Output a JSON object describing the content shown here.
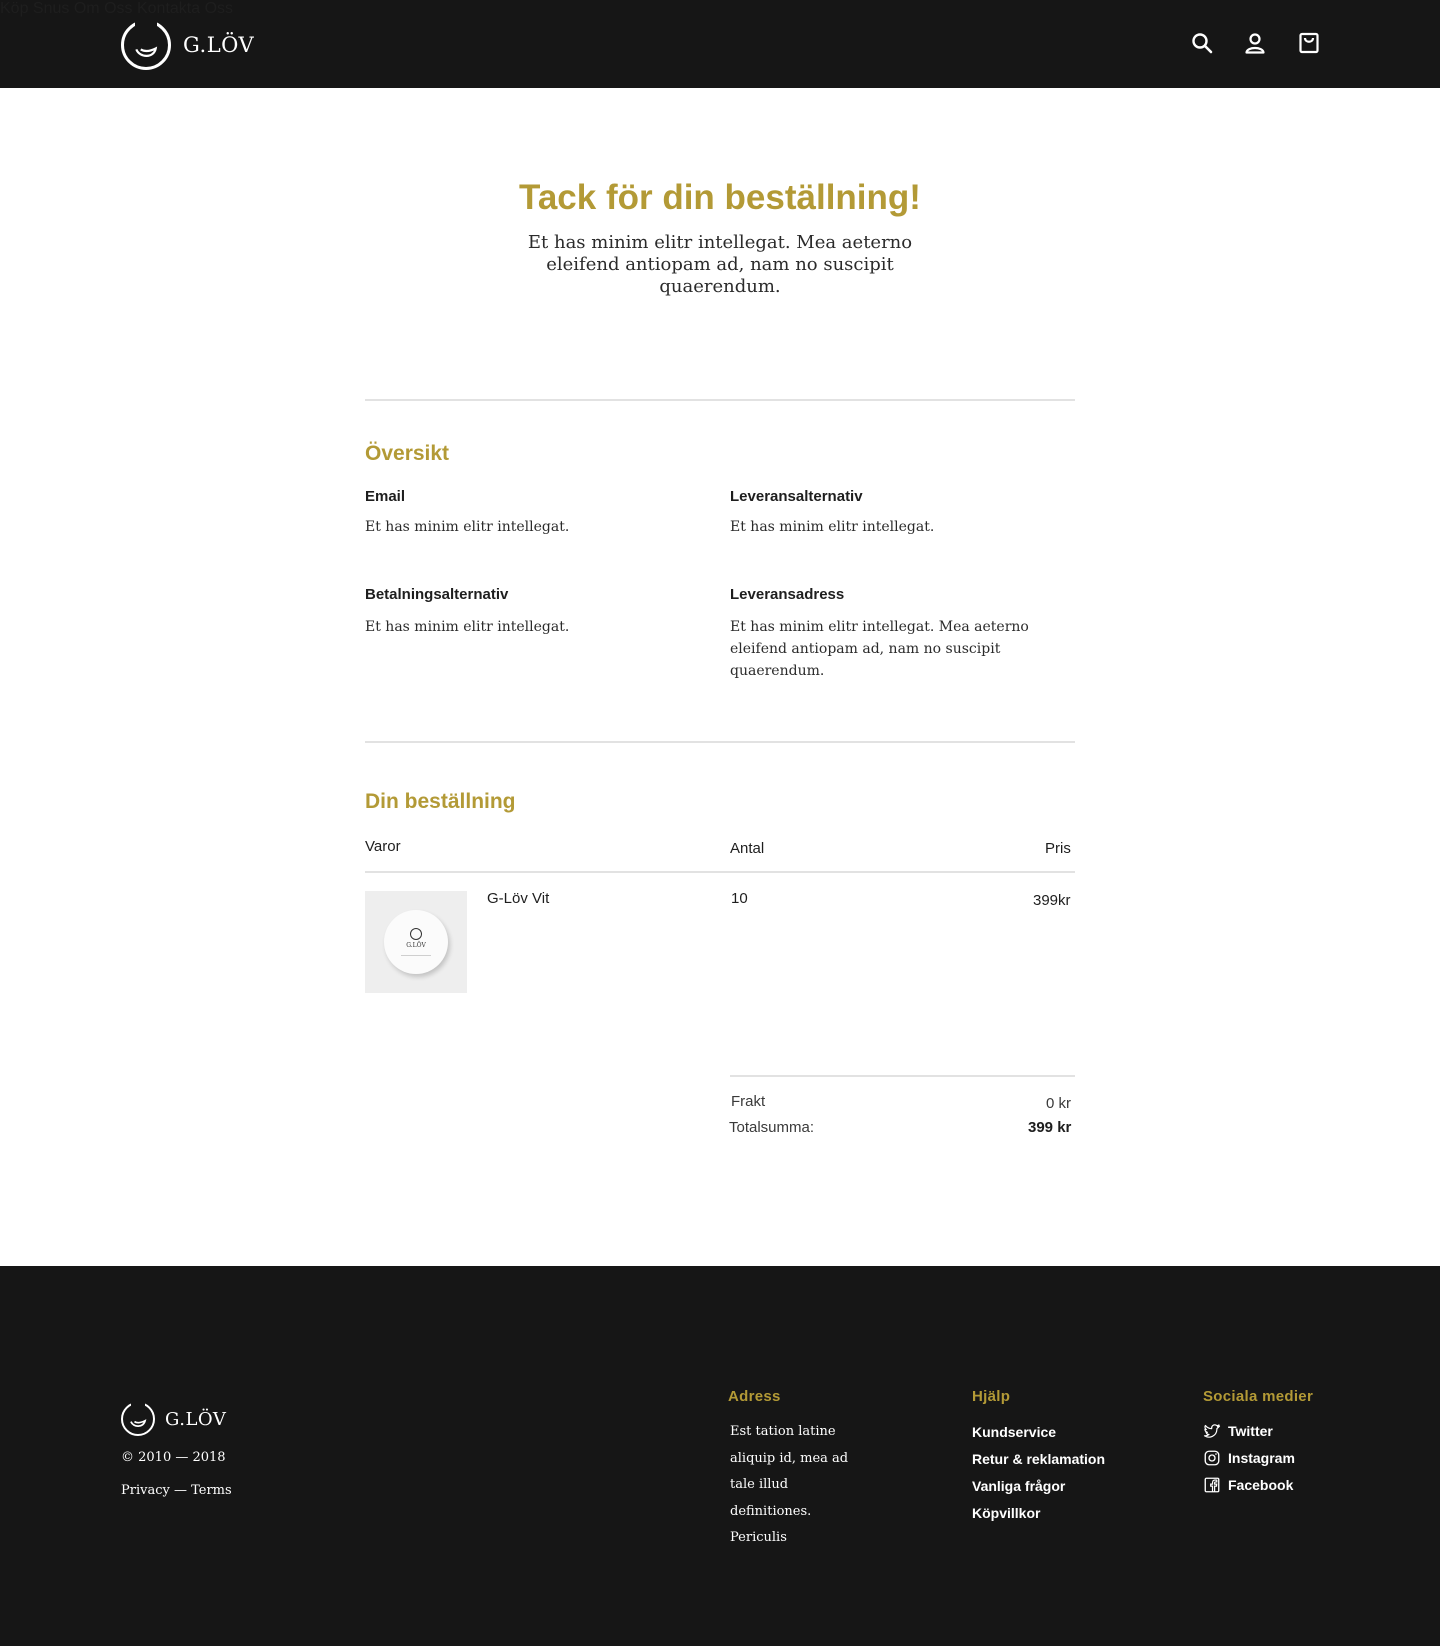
{
  "brand": {
    "name": "G.LÖV"
  },
  "nav": {
    "items": [
      "Köp Snus",
      "Om Oss",
      "Kontakta Oss"
    ]
  },
  "icons": {
    "search": "search-icon",
    "account": "user-icon",
    "cart": "shopping-bag-icon"
  },
  "colors": {
    "header_bg": "#161616",
    "accent": "#b39a36",
    "divider": "#e2e2e2"
  },
  "hero": {
    "title": "Tack för din beställning!",
    "text": "Et has minim elitr intellegat. Mea aeterno eleifend antiopam ad, nam no suscipit quaerendum."
  },
  "overview": {
    "title": "Översikt",
    "email_label": "Email",
    "email_value": "Et has minim elitr intellegat.",
    "delivery_option_label": "Leveransalternativ",
    "delivery_option_value": "Et has minim elitr intellegat.",
    "payment_label": "Betalningsalternativ",
    "payment_value": "Et has minim elitr intellegat.",
    "address_label": "Leveransadress",
    "address_value": "Et has minim elitr intellegat. Mea aeterno eleifend antiopam ad, nam no suscipit quaerendum."
  },
  "order": {
    "title": "Din beställning",
    "col_items": "Varor",
    "col_qty": "Antal",
    "col_price": "Pris",
    "items": [
      {
        "name": "G-Löv Vit",
        "qty": "10",
        "price": "399kr",
        "image_text": "G.LÖV"
      }
    ],
    "shipping_label": "Frakt",
    "shipping_value": "0 kr",
    "total_label": "Totalsumma:",
    "total_value": "399 kr"
  },
  "footer": {
    "copyright": "© 2010 — 2018",
    "legal": "Privacy — Terms",
    "address_title": "Adress",
    "address_text": "Est tation latine aliquip id, mea ad tale illud definitiones. Periculis",
    "help_title": "Hjälp",
    "help_links": [
      "Kundservice",
      "Retur & reklamation",
      "Vanliga frågor",
      "Köpvillkor"
    ],
    "social_title": "Sociala medier",
    "social_links": [
      {
        "label": "Twitter",
        "icon": "twitter-icon"
      },
      {
        "label": "Instagram",
        "icon": "instagram-icon"
      },
      {
        "label": "Facebook",
        "icon": "facebook-icon"
      }
    ]
  }
}
